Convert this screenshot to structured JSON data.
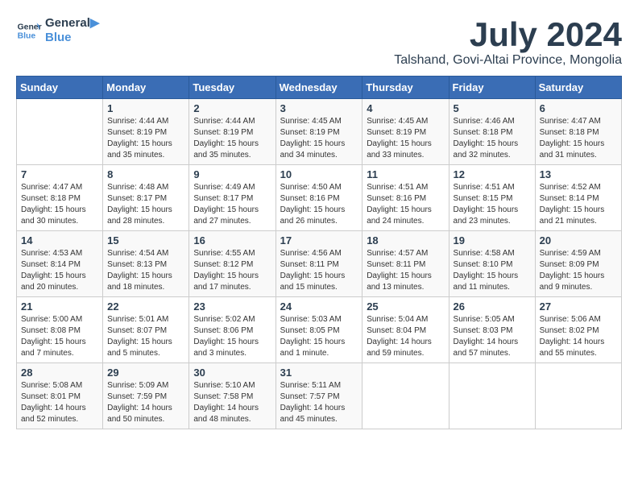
{
  "header": {
    "logo_line1": "General",
    "logo_line2": "Blue",
    "title": "July 2024",
    "subtitle": "Talshand, Govi-Altai Province, Mongolia"
  },
  "days_of_week": [
    "Sunday",
    "Monday",
    "Tuesday",
    "Wednesday",
    "Thursday",
    "Friday",
    "Saturday"
  ],
  "weeks": [
    [
      {
        "day": "",
        "info": ""
      },
      {
        "day": "1",
        "info": "Sunrise: 4:44 AM\nSunset: 8:19 PM\nDaylight: 15 hours\nand 35 minutes."
      },
      {
        "day": "2",
        "info": "Sunrise: 4:44 AM\nSunset: 8:19 PM\nDaylight: 15 hours\nand 35 minutes."
      },
      {
        "day": "3",
        "info": "Sunrise: 4:45 AM\nSunset: 8:19 PM\nDaylight: 15 hours\nand 34 minutes."
      },
      {
        "day": "4",
        "info": "Sunrise: 4:45 AM\nSunset: 8:19 PM\nDaylight: 15 hours\nand 33 minutes."
      },
      {
        "day": "5",
        "info": "Sunrise: 4:46 AM\nSunset: 8:18 PM\nDaylight: 15 hours\nand 32 minutes."
      },
      {
        "day": "6",
        "info": "Sunrise: 4:47 AM\nSunset: 8:18 PM\nDaylight: 15 hours\nand 31 minutes."
      }
    ],
    [
      {
        "day": "7",
        "info": "Sunrise: 4:47 AM\nSunset: 8:18 PM\nDaylight: 15 hours\nand 30 minutes."
      },
      {
        "day": "8",
        "info": "Sunrise: 4:48 AM\nSunset: 8:17 PM\nDaylight: 15 hours\nand 28 minutes."
      },
      {
        "day": "9",
        "info": "Sunrise: 4:49 AM\nSunset: 8:17 PM\nDaylight: 15 hours\nand 27 minutes."
      },
      {
        "day": "10",
        "info": "Sunrise: 4:50 AM\nSunset: 8:16 PM\nDaylight: 15 hours\nand 26 minutes."
      },
      {
        "day": "11",
        "info": "Sunrise: 4:51 AM\nSunset: 8:16 PM\nDaylight: 15 hours\nand 24 minutes."
      },
      {
        "day": "12",
        "info": "Sunrise: 4:51 AM\nSunset: 8:15 PM\nDaylight: 15 hours\nand 23 minutes."
      },
      {
        "day": "13",
        "info": "Sunrise: 4:52 AM\nSunset: 8:14 PM\nDaylight: 15 hours\nand 21 minutes."
      }
    ],
    [
      {
        "day": "14",
        "info": "Sunrise: 4:53 AM\nSunset: 8:14 PM\nDaylight: 15 hours\nand 20 minutes."
      },
      {
        "day": "15",
        "info": "Sunrise: 4:54 AM\nSunset: 8:13 PM\nDaylight: 15 hours\nand 18 minutes."
      },
      {
        "day": "16",
        "info": "Sunrise: 4:55 AM\nSunset: 8:12 PM\nDaylight: 15 hours\nand 17 minutes."
      },
      {
        "day": "17",
        "info": "Sunrise: 4:56 AM\nSunset: 8:11 PM\nDaylight: 15 hours\nand 15 minutes."
      },
      {
        "day": "18",
        "info": "Sunrise: 4:57 AM\nSunset: 8:11 PM\nDaylight: 15 hours\nand 13 minutes."
      },
      {
        "day": "19",
        "info": "Sunrise: 4:58 AM\nSunset: 8:10 PM\nDaylight: 15 hours\nand 11 minutes."
      },
      {
        "day": "20",
        "info": "Sunrise: 4:59 AM\nSunset: 8:09 PM\nDaylight: 15 hours\nand 9 minutes."
      }
    ],
    [
      {
        "day": "21",
        "info": "Sunrise: 5:00 AM\nSunset: 8:08 PM\nDaylight: 15 hours\nand 7 minutes."
      },
      {
        "day": "22",
        "info": "Sunrise: 5:01 AM\nSunset: 8:07 PM\nDaylight: 15 hours\nand 5 minutes."
      },
      {
        "day": "23",
        "info": "Sunrise: 5:02 AM\nSunset: 8:06 PM\nDaylight: 15 hours\nand 3 minutes."
      },
      {
        "day": "24",
        "info": "Sunrise: 5:03 AM\nSunset: 8:05 PM\nDaylight: 15 hours\nand 1 minute."
      },
      {
        "day": "25",
        "info": "Sunrise: 5:04 AM\nSunset: 8:04 PM\nDaylight: 14 hours\nand 59 minutes."
      },
      {
        "day": "26",
        "info": "Sunrise: 5:05 AM\nSunset: 8:03 PM\nDaylight: 14 hours\nand 57 minutes."
      },
      {
        "day": "27",
        "info": "Sunrise: 5:06 AM\nSunset: 8:02 PM\nDaylight: 14 hours\nand 55 minutes."
      }
    ],
    [
      {
        "day": "28",
        "info": "Sunrise: 5:08 AM\nSunset: 8:01 PM\nDaylight: 14 hours\nand 52 minutes."
      },
      {
        "day": "29",
        "info": "Sunrise: 5:09 AM\nSunset: 7:59 PM\nDaylight: 14 hours\nand 50 minutes."
      },
      {
        "day": "30",
        "info": "Sunrise: 5:10 AM\nSunset: 7:58 PM\nDaylight: 14 hours\nand 48 minutes."
      },
      {
        "day": "31",
        "info": "Sunrise: 5:11 AM\nSunset: 7:57 PM\nDaylight: 14 hours\nand 45 minutes."
      },
      {
        "day": "",
        "info": ""
      },
      {
        "day": "",
        "info": ""
      },
      {
        "day": "",
        "info": ""
      }
    ]
  ]
}
